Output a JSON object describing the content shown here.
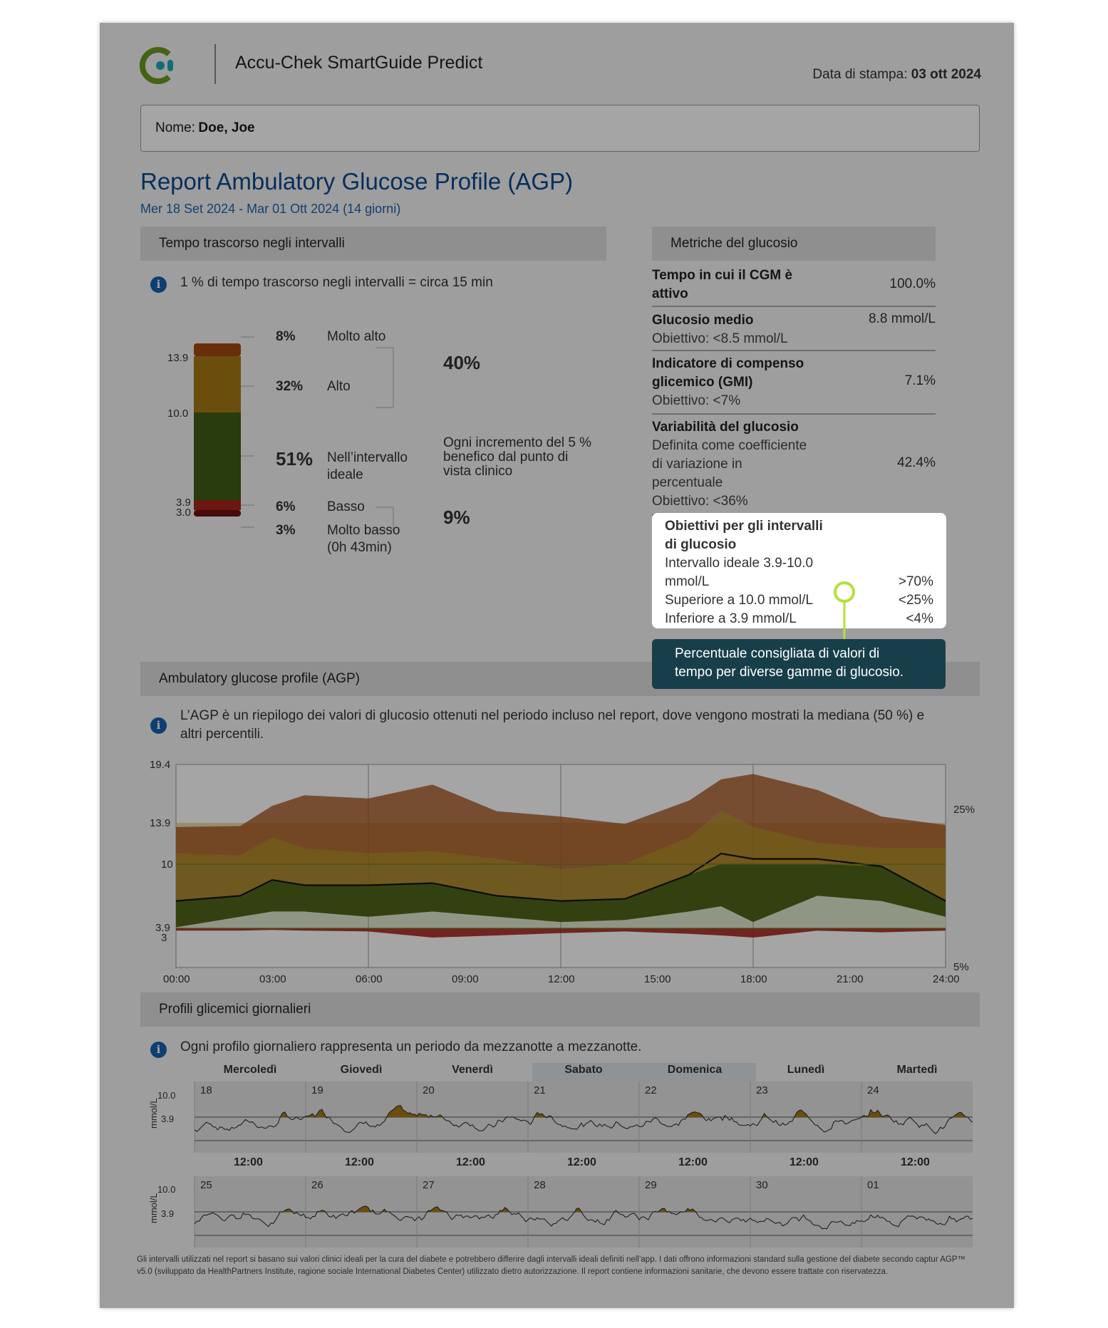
{
  "header": {
    "app_title": "Accu-Chek SmartGuide Predict",
    "print_date_label": "Data di stampa:",
    "print_date_value": "03 ott 2024"
  },
  "patient": {
    "name_label": "Nome:",
    "name_value": "Doe, Joe"
  },
  "report": {
    "title": "Report Ambulatory Glucose Profile (AGP)",
    "period": "Mer 18 Set 2024 - Mar 01 Ott 2024 (14 giorni)"
  },
  "time_in_ranges": {
    "section_title": "Tempo trascorso negli intervalli",
    "info_text": "1 % di tempo trascorso negli intervalli = circa 15 min",
    "ticks": [
      "13.9",
      "10.0",
      "3.9",
      "3.0"
    ],
    "rows": [
      {
        "pct": "8%",
        "label": "Molto alto",
        "value": 8,
        "color": "#a24a12"
      },
      {
        "pct": "32%",
        "label": "Alto",
        "value": 32,
        "color": "#a67913"
      },
      {
        "pct": "51%",
        "label": "Nell’intervallo",
        "label2": "ideale",
        "value": 51,
        "color": "#3f5e16"
      },
      {
        "pct": "6%",
        "label": "Basso",
        "value": 6,
        "color": "#a8241c"
      },
      {
        "pct": "3%",
        "label": "Molto basso",
        "label2": "(0h 43min)",
        "value": 3,
        "color": "#6f1310"
      }
    ],
    "high_total": "40%",
    "low_total": "9%",
    "note_line1": "Ogni incremento del 5 %",
    "note_line2": "benefico dal punto di",
    "note_line3": "vista clinico"
  },
  "metrics": {
    "section_title": "Metriche del glucosio",
    "cgm_label_1": "Tempo in cui il CGM è",
    "cgm_label_2": "attivo",
    "cgm_value": "100.0%",
    "mean_label": "Glucosio medio",
    "mean_target": "Obiettivo: <8.5 mmol/L",
    "mean_value": "8.8 mmol/L",
    "gmi_label_1": "Indicatore di compenso",
    "gmi_label_2": "glicemico (GMI)",
    "gmi_target": "Obiettivo: <7%",
    "gmi_value": "7.1%",
    "var_label": "Variabilità del glucosio",
    "var_desc_1": "Definita come coefficiente",
    "var_desc_2": "di variazione in",
    "var_desc_3": "percentuale",
    "var_target": "Obiettivo: <36%",
    "var_value": "42.4%"
  },
  "targets": {
    "title_1": "Obiettivi per gli intervalli",
    "title_2": "di glucosio",
    "ideal_1": "Intervallo ideale 3.9-10.0",
    "ideal_2": "mmol/L",
    "ideal_value": ">70%",
    "above": "Superiore a 10.0 mmol/L",
    "above_value": "<25%",
    "below": "Inferiore a 3.9 mmol/L",
    "below_value": "<4%"
  },
  "tooltip": {
    "line1": "Percentuale consigliata di valori di",
    "line2": "tempo per diverse gamme di glucosio."
  },
  "agp": {
    "section_title": "Ambulatory glucose profile (AGP)",
    "info_line1": "L’AGP è un riepilogo dei valori di glucosio ottenuti nel periodo incluso nel report, dove vengono mostrati la mediana (50 %) e",
    "info_line2": "altri percentili.",
    "y_ticks": [
      "19.4",
      "13.9",
      "10",
      "3.9",
      "3"
    ],
    "x_ticks": [
      "00:00",
      "03:00",
      "06:00",
      "09:00",
      "12:00",
      "15:00",
      "18:00",
      "21:00",
      "24:00"
    ],
    "pct_top": "25%",
    "pct_bottom": "5%"
  },
  "chart_data": {
    "type": "area",
    "title": "Ambulatory glucose profile (AGP)",
    "xlabel": "",
    "ylabel": "",
    "x": [
      "00:00",
      "02:00",
      "03:00",
      "04:00",
      "06:00",
      "08:00",
      "10:00",
      "12:00",
      "14:00",
      "16:00",
      "17:00",
      "18:00",
      "20:00",
      "22:00",
      "24:00"
    ],
    "ylim": [
      0,
      19.4
    ],
    "series": [
      {
        "values": [
          13.5,
          13.6,
          15.5,
          16.5,
          16.2,
          17.5,
          15.0,
          14.5,
          13.8,
          16.0,
          18.0,
          18.5,
          17.0,
          14.5,
          13.7
        ]
      },
      {
        "values": [
          11.0,
          10.8,
          12.5,
          11.5,
          11.0,
          11.2,
          10.5,
          9.5,
          10.0,
          12.5,
          15.0,
          13.5,
          12.0,
          11.5,
          11.5
        ]
      },
      {
        "values": [
          6.5,
          7.0,
          8.5,
          8.0,
          8.0,
          8.2,
          7.0,
          6.5,
          6.7,
          9.0,
          11.0,
          10.5,
          10.5,
          9.8,
          6.5
        ]
      },
      {
        "values": [
          4.0,
          5.0,
          5.5,
          5.5,
          5.0,
          5.5,
          5.0,
          4.5,
          4.7,
          5.5,
          6.0,
          4.5,
          7.0,
          6.5,
          5.0
        ]
      },
      {
        "values": [
          3.6,
          3.6,
          3.7,
          3.6,
          3.5,
          2.8,
          3.0,
          3.3,
          3.5,
          3.2,
          3.0,
          2.8,
          3.6,
          3.4,
          3.6
        ]
      }
    ]
  },
  "daily": {
    "section_title": "Profili glicemici giornalieri",
    "info_text": "Ogni profilo giornaliero rappresenta un periodo da mezzanotte a mezzanotte.",
    "day_names": [
      "Mercoledì",
      "Giovedì",
      "Venerdì",
      "Sabato",
      "Domenica",
      "Lunedì",
      "Martedì"
    ],
    "week1_dates": [
      "18",
      "19",
      "20",
      "21",
      "22",
      "23",
      "24"
    ],
    "week2_dates": [
      "25",
      "26",
      "27",
      "28",
      "29",
      "30",
      "01"
    ],
    "mid_label": "12:00",
    "y_unit": "mmol/L",
    "y_high": "10.0",
    "y_low": "3.9"
  },
  "footer": {
    "text": "Gli intervalli utilizzati nel report si basano sui valori clinici ideali per la cura del diabete e potrebbero differire dagli intervalli ideali definiti nell’app. I dati offrono informazioni standard sulla gestione del diabete secondo captur AGP™ v5.0 (sviluppato da HealthPartners Institute, ragione sociale International Diabetes Center) utilizzato dietro autorizzazione. Il report contiene informazioni sanitarie, che devono essere trattate con riservatezza."
  },
  "colors": {
    "very_high": "#a24a12",
    "high": "#a67913",
    "ideal": "#3f5e16",
    "low": "#a8241c",
    "very_low": "#6f1310",
    "title_blue": "#0a4a8f",
    "tooltip_bg": "#173f4a",
    "focus_ring": "#b4e03c"
  }
}
